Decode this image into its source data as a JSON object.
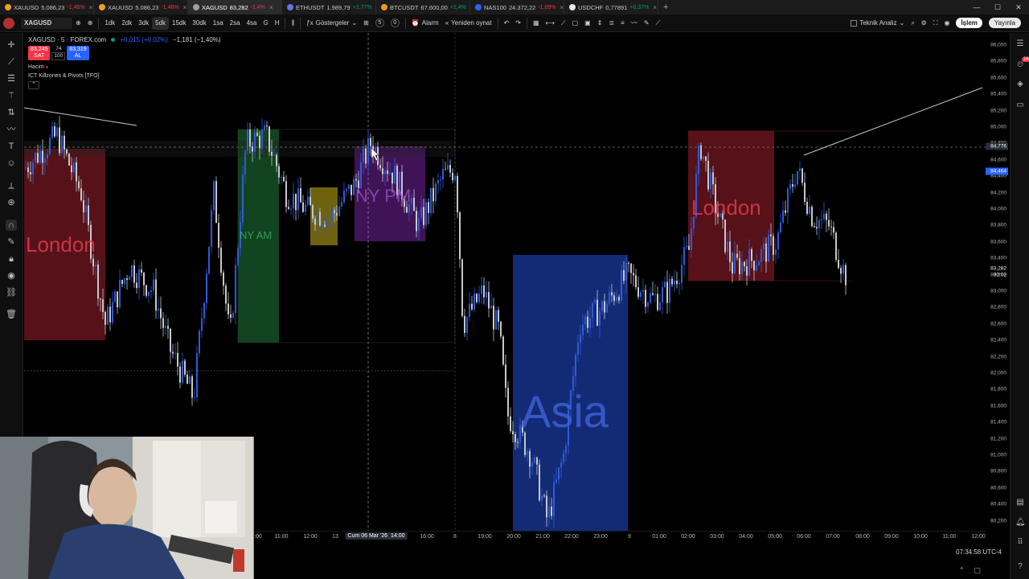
{
  "browser_tabs": [
    {
      "name": "XAUUSD",
      "price": "5.086,23",
      "change": "-1,46%",
      "fav_color": "#e8a317",
      "active": false
    },
    {
      "name": "XAUUSD",
      "price": "5.086,23",
      "change": "-1,46%",
      "fav_color": "#e8a317",
      "active": false
    },
    {
      "name": "XAGUSD",
      "price": "83,282",
      "change": "-1,4%",
      "fav_color": "#9aa0a6",
      "active": true
    },
    {
      "name": "ETHUSDT",
      "price": "1.989,79",
      "change": "+2,77%",
      "fav_color": "#6272ea",
      "active": false
    },
    {
      "name": "BTCUSDT",
      "price": "67.600,00",
      "change": "+2,4%",
      "fav_color": "#f7931a",
      "active": false
    },
    {
      "name": "NAS100",
      "price": "24.372,22",
      "change": "-1,09%",
      "fav_color": "#2962ff",
      "active": false
    },
    {
      "name": "USDCHF",
      "price": "0,77891",
      "change": "+0,37%",
      "fav_color": "#e8e8e8",
      "active": false
    }
  ],
  "toolbar": {
    "symbol": "XAGUSD",
    "intervals": [
      "1dk",
      "2dk",
      "3dk",
      "5dk",
      "15dk",
      "30dk",
      "1sa",
      "2sa",
      "4sa",
      "G",
      "H"
    ],
    "active_interval": "5dk",
    "indicators_label": "Göstergeler",
    "count_a": "5",
    "count_b": "0",
    "alarm_label": "Alarm",
    "replay_label": "Yeniden oynat",
    "analysis_label": "Teknik Analiz",
    "trade_label": "İşlem",
    "publish_label": "Yayınla"
  },
  "legend": {
    "title": "XAGUSD · 5 · FOREX.com",
    "change": "+0,015 (+0,02%)",
    "change2": "−1,181 (−1,40%)",
    "sell_price": "83,245",
    "sell_label": "SAT",
    "spread": "74",
    "lot": "100",
    "buy_price": "83,319",
    "buy_label": "AL",
    "volume_label": "Hacim",
    "indicator_label": "ICT Killzones & Pivots [TFO]"
  },
  "zones": {
    "london1": "London",
    "ny_am": "NY AM",
    "ny_pm": "NY PM",
    "asia": "Asia",
    "london2": "London"
  },
  "price_axis": {
    "labels": [
      "86,000",
      "85,800",
      "85,600",
      "85,400",
      "85,200",
      "85,000",
      "84,800",
      "84,600",
      "84,400",
      "84,200",
      "84,000",
      "83,800",
      "83,600",
      "83,400",
      "83,200",
      "83,000",
      "82,800",
      "82,600",
      "82,400",
      "82,200",
      "82,000",
      "81,800",
      "81,600",
      "81,400",
      "81,200",
      "81,000",
      "80,800",
      "80,600",
      "80,400",
      "80,200"
    ],
    "crosshair_price": "84,776",
    "last_price": "84,464",
    "current_price": "83,282",
    "countdown": "00:02"
  },
  "time_axis": {
    "labels": [
      "10:00",
      "11:00",
      "12:00",
      "13",
      "15:00",
      "16:00",
      "8",
      "19:00",
      "20:00",
      "21:00",
      "22:00",
      "23:00",
      "9",
      "01:00",
      "02:00",
      "03:00",
      "04:00",
      "05:00",
      "06:00",
      "07:00",
      "08:00",
      "09:00",
      "10:00",
      "11:00",
      "12:00"
    ],
    "crosshair_time": "Cum 06 Mar '26",
    "crosshair_hour": "14:00"
  },
  "status": {
    "clock": "07:34:58 UTC-4"
  },
  "colors": {
    "london": "#9c1f2e",
    "ny_am": "#1f7a3a",
    "ny_pm": "#6a1f8f",
    "asia": "#1a3a9c",
    "lunch": "#c9b21c",
    "candle_up": "#2f5bd9",
    "candle_down": "#c8c8c8"
  }
}
